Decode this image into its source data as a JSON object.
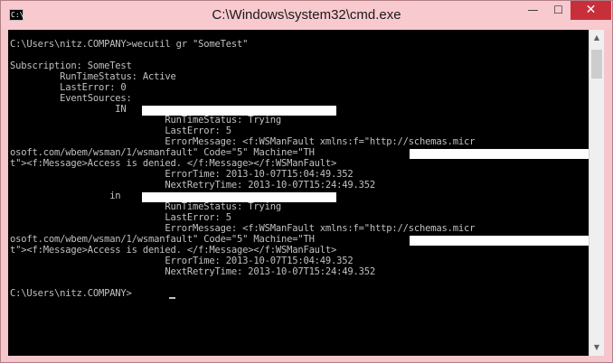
{
  "window": {
    "title": "C:\\Windows\\system32\\cmd.exe",
    "icon_label": "C:\\",
    "controls": {
      "minimize": "—",
      "maximize": "☐",
      "close": "✕"
    }
  },
  "console": {
    "lines": [
      "C:\\Users\\nitz.COMPANY>wecutil gr \"SomeTest\"",
      "",
      "Subscription: SomeTest",
      "         RunTimeStatus: Active",
      "         LastError: 0",
      "         EventSources:",
      "                   IN",
      "                            RunTimeStatus: Trying",
      "                            LastError: 5",
      "                            ErrorMessage: <f:WSManFault xmlns:f=\"http://schemas.micr",
      "osoft.com/wbem/wsman/1/wsmanfault\" Code=\"5\" Machine=\"TH",
      "t\"><f:Message>Access is denied. </f:Message></f:WSManFault>",
      "                            ErrorTime: 2013-10-07T15:04:49.352",
      "                            NextRetryTime: 2013-10-07T15:24:49.352",
      "                  in",
      "                            RunTimeStatus: Trying",
      "                            LastError: 5",
      "                            ErrorMessage: <f:WSManFault xmlns:f=\"http://schemas.micr",
      "osoft.com/wbem/wsman/1/wsmanfault\" Code=\"5\" Machine=\"TH",
      "t\"><f:Message>Access is denied. </f:Message></f:WSManFault>",
      "                            ErrorTime: 2013-10-07T15:04:49.352",
      "                            NextRetryTime: 2013-10-07T15:24:49.352",
      "",
      "C:\\Users\\nitz.COMPANY>"
    ]
  },
  "colors": {
    "console_bg": "#000000",
    "console_text": "#c0c0c0",
    "titlebar": "#f8c9ce",
    "close_button": "#c7303a"
  }
}
